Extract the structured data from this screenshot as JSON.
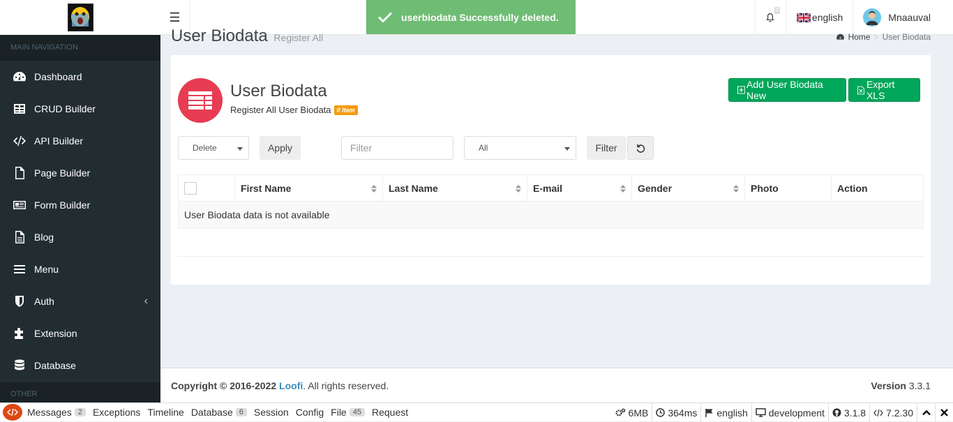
{
  "sidebar": {
    "header": "MAIN NAVIGATION",
    "other": "OTHER",
    "items": [
      {
        "label": "Dashboard"
      },
      {
        "label": "CRUD Builder"
      },
      {
        "label": "API Builder"
      },
      {
        "label": "Page Builder"
      },
      {
        "label": "Form Builder"
      },
      {
        "label": "Blog"
      },
      {
        "label": "Menu"
      },
      {
        "label": "Auth"
      },
      {
        "label": "Extension"
      },
      {
        "label": "Database"
      }
    ]
  },
  "topbar": {
    "notif_count": "0",
    "language": "english",
    "username": "Mnaauval"
  },
  "toast": {
    "message": "userbiodata Successfully deleted."
  },
  "page": {
    "title": "User Biodata",
    "subtitle": "Register All",
    "breadcrumb_home": "Home",
    "breadcrumb_sep": ">",
    "breadcrumb_current": "User Biodata"
  },
  "box": {
    "title": "User Biodata",
    "subtitle": "Register All User Biodata",
    "item_badge": "0 Item",
    "add_button": "Add User Biodata New",
    "export_button": "Export XLS",
    "bulk_action": "Delete",
    "apply_button": "Apply",
    "filter_placeholder": "Filter",
    "field_select": "All",
    "filter_button": "Filter"
  },
  "table": {
    "columns": [
      "First Name",
      "Last Name",
      "E-mail",
      "Gender",
      "Photo",
      "Action"
    ],
    "empty_message": "User Biodata data is not available"
  },
  "footer": {
    "copyright_prefix": "Copyright © 2016-2022 ",
    "brand": "Loofi",
    "copyright_suffix": ". All rights reserved.",
    "version_label": "Version",
    "version": "3.3.1"
  },
  "debugbar": {
    "tabs": [
      {
        "label": "Messages",
        "count": "2"
      },
      {
        "label": "Exceptions",
        "count": ""
      },
      {
        "label": "Timeline",
        "count": ""
      },
      {
        "label": "Database",
        "count": "6"
      },
      {
        "label": "Session",
        "count": ""
      },
      {
        "label": "Config",
        "count": ""
      },
      {
        "label": "File",
        "count": "45"
      },
      {
        "label": "Request",
        "count": ""
      }
    ],
    "memory": "6MB",
    "time": "364ms",
    "locale": "english",
    "env": "development",
    "ci_version": "3.1.8",
    "php_version": "7.2.30"
  },
  "colors": {
    "accent": "#00a65a",
    "sidebar": "#222d32",
    "toast": "#6fbc74",
    "brand_icon": "#e83c52"
  }
}
